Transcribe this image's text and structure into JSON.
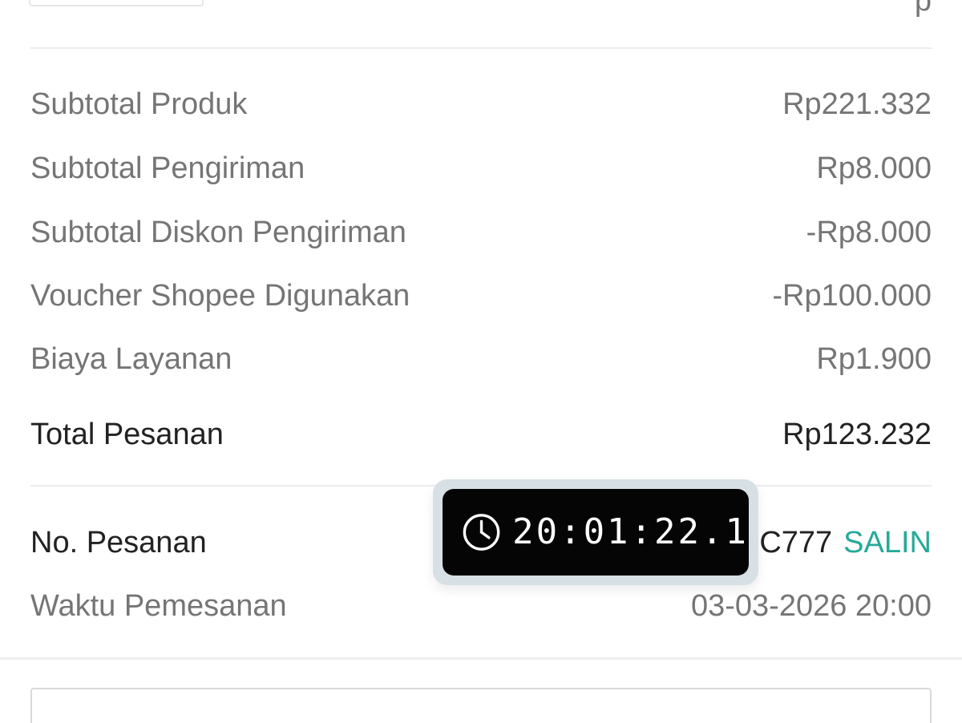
{
  "top_fragment": "p",
  "summary": {
    "rows": [
      {
        "label": "Subtotal Produk",
        "value": "Rp221.332"
      },
      {
        "label": "Subtotal Pengiriman",
        "value": "Rp8.000"
      },
      {
        "label": "Subtotal Diskon Pengiriman",
        "value": "-Rp8.000"
      },
      {
        "label": "Voucher Shopee Digunakan",
        "value": "-Rp100.000"
      },
      {
        "label": "Biaya Layanan",
        "value": "Rp1.900"
      }
    ],
    "total": {
      "label": "Total Pesanan",
      "value": "Rp123.232"
    }
  },
  "order": {
    "number_label": "No. Pesanan",
    "number_visible_fragment": "C777",
    "copy_label": "SALIN",
    "time_label": "Waktu Pemesanan",
    "time_value": "03-03-2026 20:00"
  },
  "clock_overlay": {
    "icon": "clock-icon",
    "time": "20:01:22.1"
  },
  "colors": {
    "accent": "#26aa99",
    "muted_text": "#757575",
    "dark_text": "#222222",
    "overlay_background": "#050505"
  }
}
